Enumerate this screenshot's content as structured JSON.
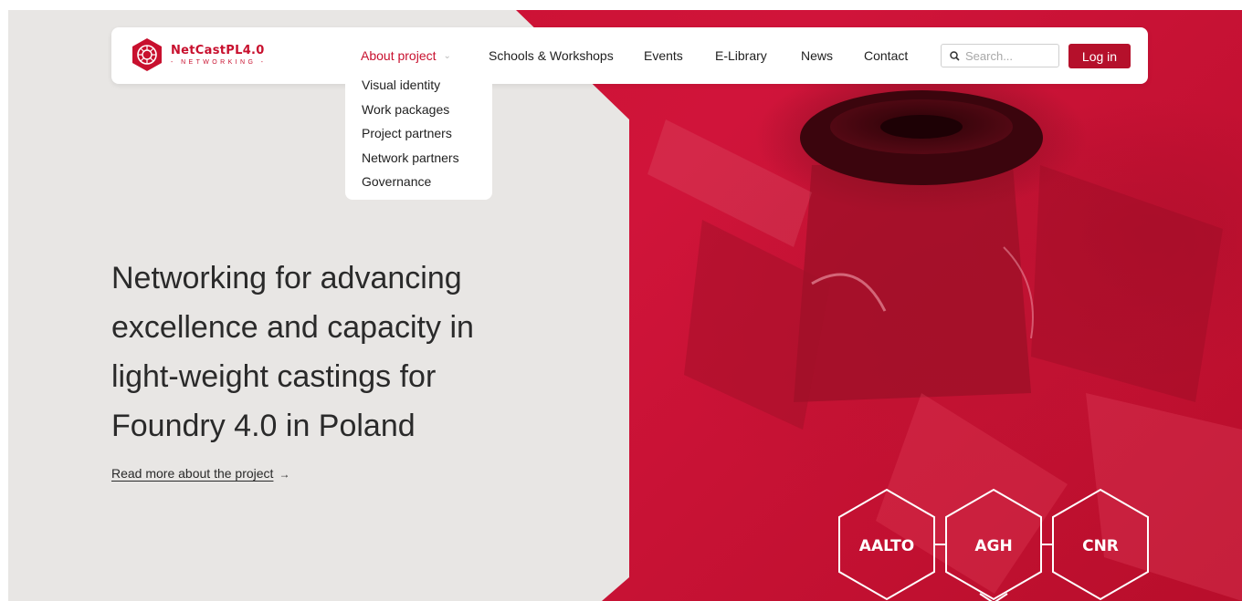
{
  "logo": {
    "title": "NetCastPL4.0",
    "subtitle": "- NETWORKING -"
  },
  "nav": {
    "items": [
      {
        "label": "About project",
        "active": true,
        "has_dropdown": true
      },
      {
        "label": "Schools & Workshops"
      },
      {
        "label": "Events"
      },
      {
        "label": "E-Library"
      },
      {
        "label": "News"
      },
      {
        "label": "Contact"
      }
    ],
    "search_placeholder": "Search...",
    "login_label": "Log in"
  },
  "dropdown": {
    "items": [
      "Visual identity",
      "Work packages",
      "Project partners",
      "Network partners",
      "Governance"
    ]
  },
  "hero": {
    "headline_lines": [
      "Networking for advancing",
      "excellence and capacity in",
      "light-weight castings for",
      "Foundry 4.0 in Poland"
    ],
    "link_label": "Read more about the project",
    "link_arrow": "→"
  },
  "partners": [
    "AALTO",
    "AGH",
    "CNR"
  ],
  "icons": {
    "search": "search-icon",
    "chevron": "chevron-down-icon",
    "logo": "logo-mark-icon"
  },
  "colors": {
    "brand_red": "#c8102e",
    "login_bg": "#b5102b",
    "hero_gray": "#e8e6e4"
  }
}
